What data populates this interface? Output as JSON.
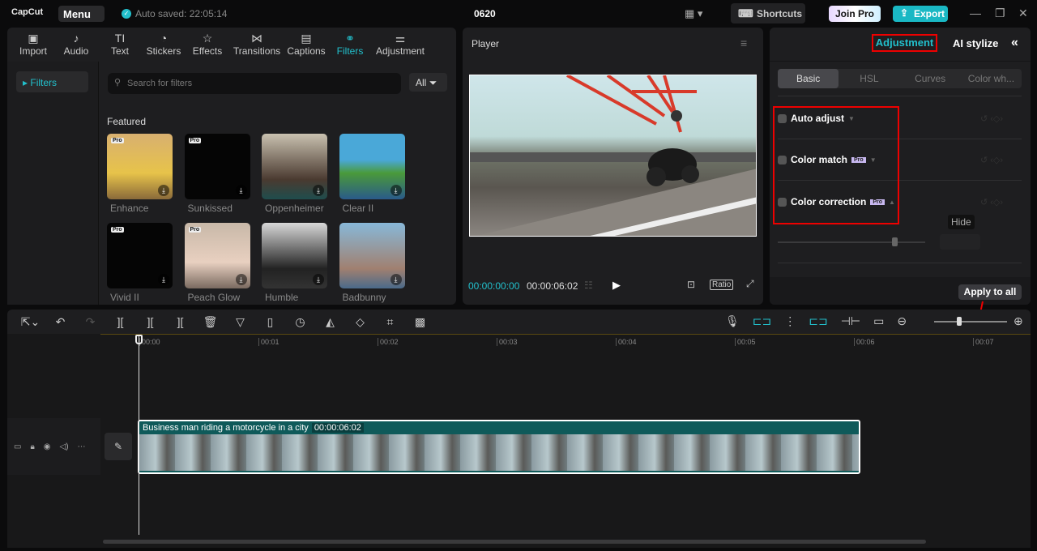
{
  "topbar": {
    "logo": "CapCut",
    "menu": "Menu",
    "autosave": "Auto saved: 22:05:14",
    "project": "0620",
    "shortcuts": "Shortcuts",
    "join_pro": "Join Pro",
    "export": "Export"
  },
  "tabs": [
    {
      "label": "Import",
      "icon": "▣"
    },
    {
      "label": "Audio",
      "icon": "♪"
    },
    {
      "label": "Text",
      "icon": "TI"
    },
    {
      "label": "Stickers",
      "icon": "◔"
    },
    {
      "label": "Effects",
      "icon": "☆"
    },
    {
      "label": "Transitions",
      "icon": "⋈"
    },
    {
      "label": "Captions",
      "icon": "▤"
    },
    {
      "label": "Filters",
      "icon": "⚭"
    },
    {
      "label": "Adjustment",
      "icon": "⚌"
    }
  ],
  "sidebar": {
    "item": "▸ Filters"
  },
  "search": {
    "placeholder": "Search for filters"
  },
  "filter_all": "All",
  "featured": "Featured",
  "filters": [
    {
      "name": "Enhance",
      "pro": true
    },
    {
      "name": "Sunkissed",
      "pro": true
    },
    {
      "name": "Oppenheimer",
      "pro": false
    },
    {
      "name": "Clear II",
      "pro": false
    },
    {
      "name": "Vivid II",
      "pro": true
    },
    {
      "name": "Peach Glow",
      "pro": true
    },
    {
      "name": "Humble",
      "pro": false
    },
    {
      "name": "Badbunny",
      "pro": false
    }
  ],
  "pro_label": "Pro",
  "player": {
    "title": "Player",
    "current": "00:00:00:00",
    "total": "00:00:06:02",
    "ratio": "Ratio"
  },
  "right": {
    "tab_adjustment": "Adjustment",
    "tab_ai": "AI stylize",
    "subtabs": [
      "Basic",
      "HSL",
      "Curves",
      "Color wh..."
    ],
    "auto_adjust": "Auto adjust",
    "color_match": "Color match",
    "color_correction": "Color correction",
    "hide": "Hide",
    "apply_all": "Apply to all"
  },
  "timeline": {
    "ticks": [
      "00:00",
      "00:01",
      "00:02",
      "00:03",
      "00:04",
      "00:05",
      "00:06",
      "00:07"
    ],
    "clip_title": "Business man riding a motorcycle in a city",
    "clip_duration": "00:00:06:02"
  }
}
